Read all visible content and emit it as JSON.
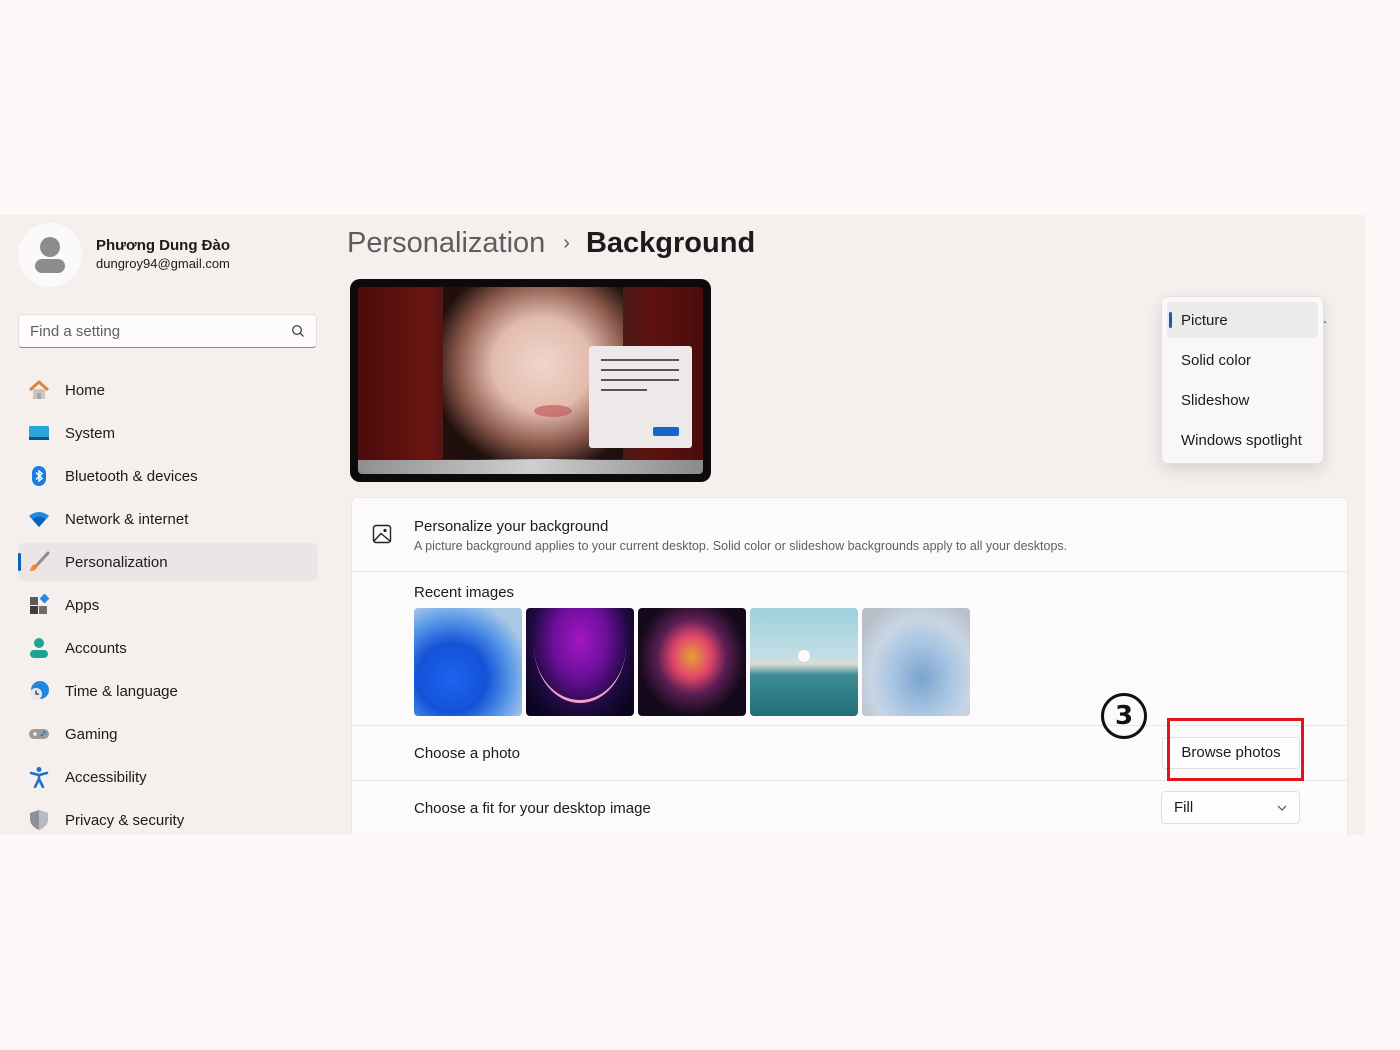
{
  "profile": {
    "name": "Phương Dung Đào",
    "email": "dungroy94@gmail.com"
  },
  "search": {
    "placeholder": "Find a setting",
    "value": ""
  },
  "sidebar": {
    "items": [
      {
        "label": "Home",
        "icon": "home-icon",
        "active": false
      },
      {
        "label": "System",
        "icon": "system-icon",
        "active": false
      },
      {
        "label": "Bluetooth & devices",
        "icon": "bluetooth-icon",
        "active": false
      },
      {
        "label": "Network & internet",
        "icon": "wifi-icon",
        "active": false
      },
      {
        "label": "Personalization",
        "icon": "paintbrush-icon",
        "active": true
      },
      {
        "label": "Apps",
        "icon": "apps-icon",
        "active": false
      },
      {
        "label": "Accounts",
        "icon": "accounts-icon",
        "active": false
      },
      {
        "label": "Time & language",
        "icon": "globe-clock-icon",
        "active": false
      },
      {
        "label": "Gaming",
        "icon": "gamepad-icon",
        "active": false
      },
      {
        "label": "Accessibility",
        "icon": "accessibility-icon",
        "active": false
      },
      {
        "label": "Privacy & security",
        "icon": "shield-icon",
        "active": false
      }
    ]
  },
  "breadcrumb": {
    "parent": "Personalization",
    "separator": "›",
    "current": "Background"
  },
  "personalize": {
    "title": "Personalize your background",
    "description": "A picture background applies to your current desktop. Solid color or slideshow backgrounds apply to all your desktops.",
    "dropdown": {
      "selected": "Picture",
      "options": [
        "Picture",
        "Solid color",
        "Slideshow",
        "Windows spotlight"
      ]
    }
  },
  "recent_images": {
    "label": "Recent images",
    "items": [
      "blue-bloom-wallpaper",
      "purple-glow-wallpaper",
      "colorful-ribbons-wallpaper",
      "lake-sunrise-wallpaper",
      "light-blue-bloom-wallpaper"
    ]
  },
  "choose_photo": {
    "label": "Choose a photo",
    "button": "Browse photos"
  },
  "choose_fit": {
    "label": "Choose a fit for your desktop image",
    "value": "Fill"
  },
  "annotation": {
    "step": "3",
    "color": "#e0141a"
  },
  "colors": {
    "accent": "#0f5fb8",
    "page_bg": "#fdf8f7",
    "app_bg": "#f5efee"
  }
}
